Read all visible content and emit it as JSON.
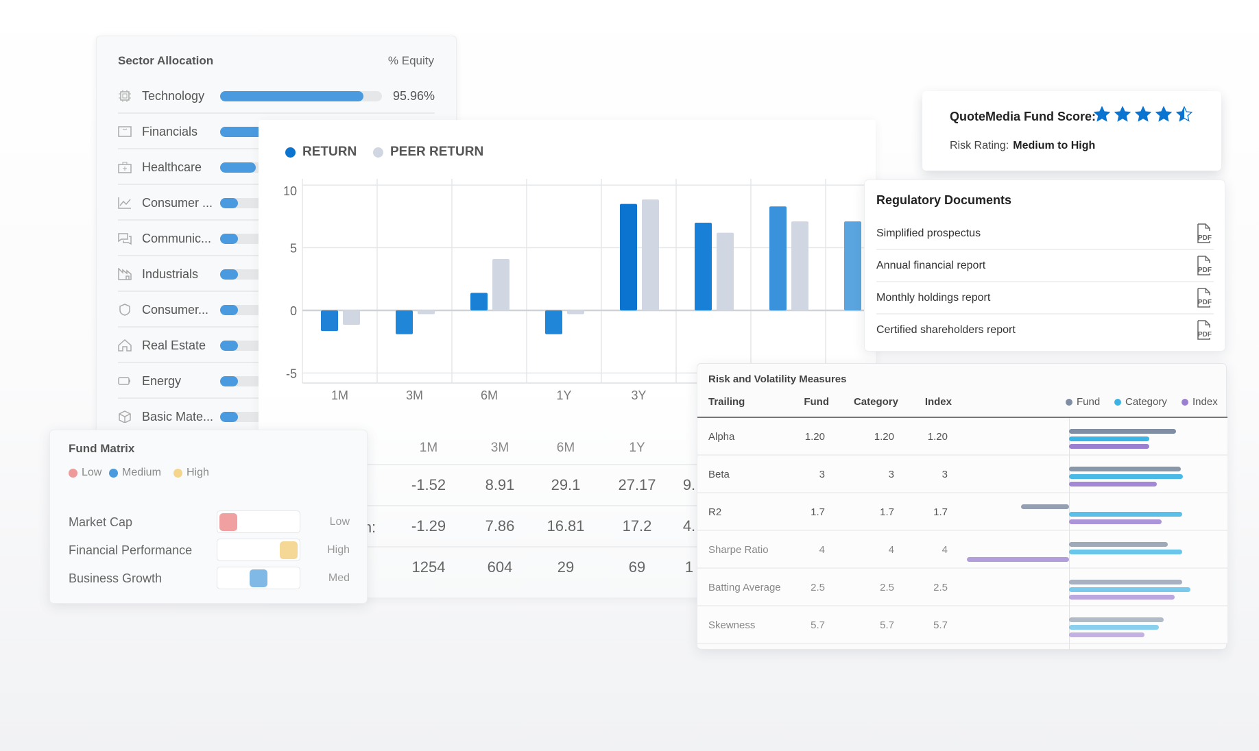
{
  "sector_allocation": {
    "title": "Sector Allocation",
    "column_label": "% Equity",
    "accent": "#4a9ae0",
    "items": [
      {
        "label": "Technology",
        "icon": "chip-icon",
        "fill": 0.886,
        "percent": "95.96%"
      },
      {
        "label": "Financials",
        "icon": "wallet-icon",
        "fill": 0.35
      },
      {
        "label": "Healthcare",
        "icon": "medical-kit-icon",
        "fill": 0.22
      },
      {
        "label": "Consumer ...",
        "icon": "line-chart-icon",
        "fill": 0.11
      },
      {
        "label": "Communic...",
        "icon": "chat-icon",
        "fill": 0.11
      },
      {
        "label": "Industrials",
        "icon": "factory-icon",
        "fill": 0.11
      },
      {
        "label": "Consumer...",
        "icon": "shield-icon",
        "fill": 0.11
      },
      {
        "label": "Real Estate",
        "icon": "house-icon",
        "fill": 0.11
      },
      {
        "label": "Energy",
        "icon": "battery-icon",
        "fill": 0.11
      },
      {
        "label": "Basic Mate...",
        "icon": "cube-icon",
        "fill": 0.11
      }
    ]
  },
  "chart_data": {
    "type": "bar",
    "categories": [
      "1M",
      "3M",
      "6M",
      "1Y",
      "3Y",
      "",
      "",
      ""
    ],
    "series": [
      {
        "name": "RETURN",
        "color": "#0a74d0",
        "values": [
          -1.65,
          -1.9,
          1.4,
          -1.9,
          8.5,
          7.0,
          8.3,
          7.1
        ],
        "bar_colors": [
          "#1f82d6",
          "#2086d8",
          "#1a80d5",
          "#2086d8",
          "#0a74d0",
          "#1880d6",
          "#3a92dc",
          "#5aa5e0"
        ]
      },
      {
        "name": "PEER RETURN",
        "color": "#d0d7e2",
        "values": [
          -1.15,
          -0.3,
          4.1,
          -0.3,
          8.85,
          6.2,
          7.1,
          null
        ]
      }
    ],
    "yticks": [
      10,
      5,
      0,
      -5
    ],
    "ylim": [
      -5.8,
      10.5
    ],
    "grid": true,
    "legend": "top-left"
  },
  "returns_table": {
    "headers": [
      "1M",
      "3M",
      "6M",
      "1Y"
    ],
    "row_label_fragment": "n:",
    "rows": [
      [
        "-1.52",
        "8.91",
        "29.1",
        "27.17",
        "9."
      ],
      [
        "-1.29",
        "7.86",
        "16.81",
        "17.2",
        "4."
      ],
      [
        "1254",
        "604",
        "29",
        "69",
        "1"
      ]
    ]
  },
  "fund_matrix": {
    "title": "Fund Matrix",
    "legend": [
      {
        "label": "Low",
        "color": "#ef9a9a"
      },
      {
        "label": "Medium",
        "color": "#4a9ae0"
      },
      {
        "label": "High",
        "color": "#f5d58c"
      }
    ],
    "rows": [
      {
        "label": "Market Cap",
        "value": "Low",
        "level": 0.0,
        "color": "#f0a0a0"
      },
      {
        "label": "Financial Performance",
        "value": "High",
        "level": 1.0,
        "color": "#f5d896"
      },
      {
        "label": "Business Growth",
        "value": "Med",
        "level": 0.5,
        "color": "#80b8e6"
      }
    ]
  },
  "risk": {
    "title": "Risk and Volatility Measures",
    "headers": {
      "trailing": "Trailing",
      "fund": "Fund",
      "category": "Category",
      "index": "Index"
    },
    "legend": [
      {
        "label": "Fund",
        "color": "#7f8ea3"
      },
      {
        "label": "Category",
        "color": "#3bb3e3"
      },
      {
        "label": "Index",
        "color": "#9b7fd1"
      }
    ],
    "rows": [
      {
        "label": "Alpha",
        "fund": "1.20",
        "category": "1.20",
        "index": "1.20",
        "bars": [
          0.89,
          0.67,
          0.67
        ]
      },
      {
        "label": "Beta",
        "fund": "3",
        "category": "3",
        "index": "3",
        "bars": [
          0.93,
          0.95,
          0.73
        ]
      },
      {
        "label": "R2",
        "fund": "1.7",
        "category": "1.7",
        "index": "1.7",
        "bars": [
          -0.4,
          0.94,
          0.77
        ]
      },
      {
        "label": "Sharpe Ratio",
        "fund": "4",
        "category": "4",
        "index": "4",
        "bars": [
          0.82,
          0.94,
          -0.85
        ]
      },
      {
        "label": "Batting Average",
        "fund": "2.5",
        "category": "2.5",
        "index": "2.5",
        "bars": [
          0.94,
          1.01,
          0.88
        ]
      },
      {
        "label": "Skewness",
        "fund": "5.7",
        "category": "5.7",
        "index": "5.7",
        "bars": [
          0.79,
          0.75,
          0.63
        ]
      }
    ]
  },
  "fund_score": {
    "title": "QuoteMedia Fund Score:",
    "stars": 4.5,
    "star_color": "#0a74d0",
    "risk_label": "Risk Rating:",
    "risk_value": "Medium to High"
  },
  "documents": {
    "title": "Regulatory Documents",
    "items": [
      {
        "label": "Simplified prospectus",
        "icon": "pdf-icon"
      },
      {
        "label": "Annual financial report",
        "icon": "pdf-icon"
      },
      {
        "label": "Monthly holdings report",
        "icon": "pdf-icon"
      },
      {
        "label": "Certified shareholders report",
        "icon": "pdf-icon"
      }
    ]
  }
}
